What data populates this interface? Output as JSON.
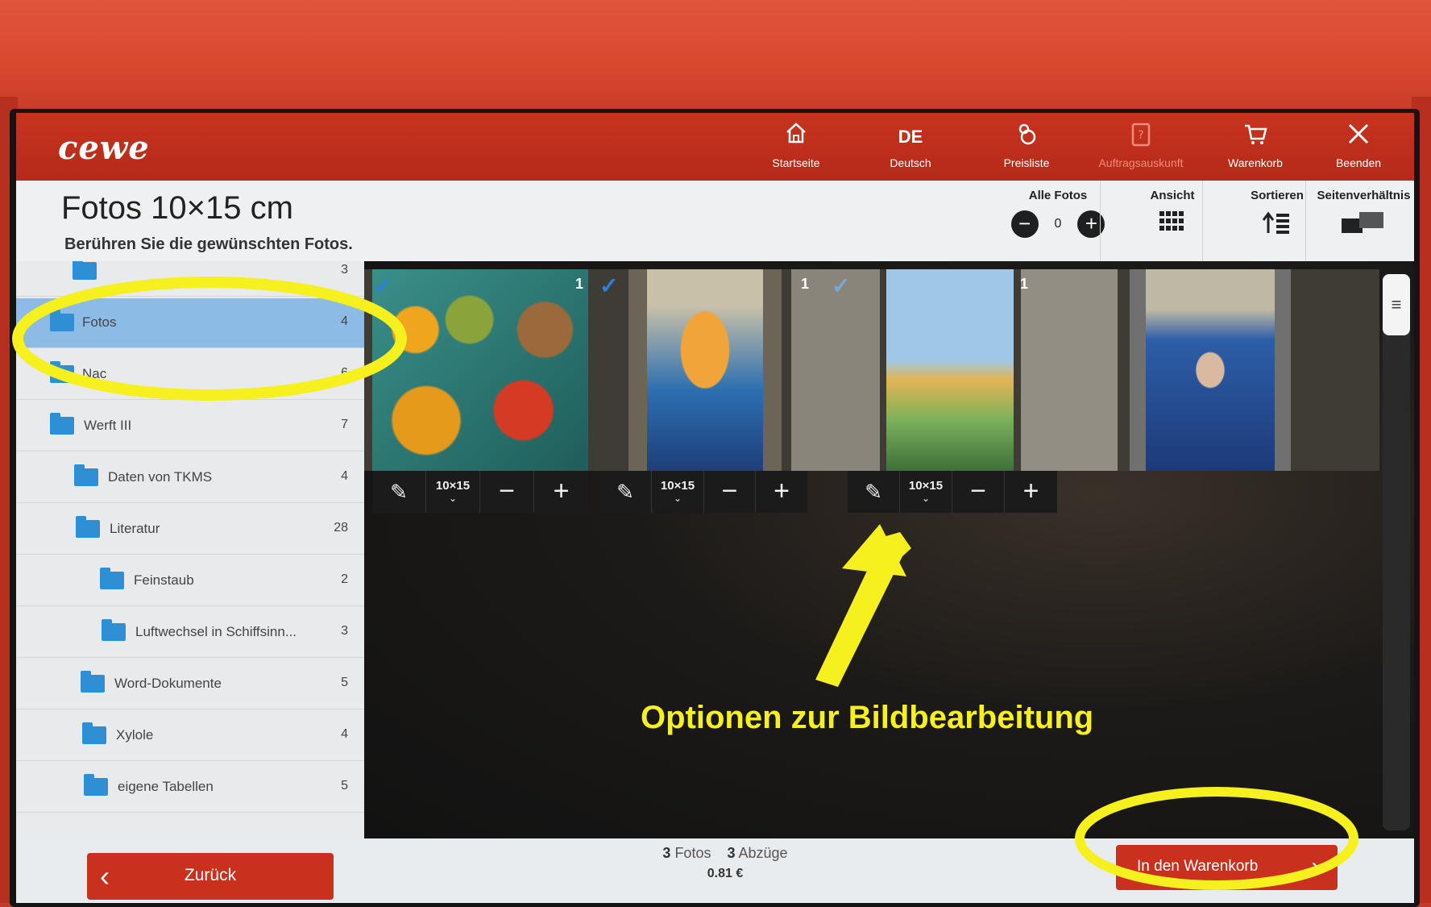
{
  "header": {
    "logo": "cewe",
    "nav": [
      {
        "label": "Startseite",
        "icon": "home-icon"
      },
      {
        "label": "Deutsch",
        "code": "DE"
      },
      {
        "label": "Preisliste",
        "icon": "price-tag-icon"
      },
      {
        "label": "Auftragsauskunft",
        "icon": "clipboard-icon"
      },
      {
        "label": "Warenkorb",
        "icon": "cart-icon"
      },
      {
        "label": "Beenden",
        "icon": "close-icon"
      }
    ]
  },
  "page": {
    "title": "Fotos 10×15 cm",
    "subtitle": "Berühren Sie die gewünschten Fotos."
  },
  "controls": {
    "all_photos_label": "Alle Fotos",
    "all_photos_count": "0",
    "view_label": "Ansicht",
    "sort_label": "Sortieren",
    "aspect_label": "Seitenverhältnis"
  },
  "folders": [
    {
      "name": "",
      "count": "3"
    },
    {
      "name": "Fotos",
      "count": "4",
      "selected": true
    },
    {
      "name": "Nac",
      "count": "6"
    },
    {
      "name": "Werft III",
      "count": "7"
    },
    {
      "name": "Daten von TKMS",
      "count": "4"
    },
    {
      "name": "Literatur",
      "count": "28"
    },
    {
      "name": "Feinstaub",
      "count": "2"
    },
    {
      "name": "Luftwechsel in Schiffsinn...",
      "count": "3"
    },
    {
      "name": "Word-Dokumente",
      "count": "5"
    },
    {
      "name": "Xylole",
      "count": "4"
    },
    {
      "name": "eigene Tabellen",
      "count": "5"
    }
  ],
  "photos": [
    {
      "qty": "1",
      "checked": true
    },
    {
      "qty": "1",
      "checked": true
    },
    {
      "qty": "1",
      "checked": true
    },
    {
      "qty": "",
      "checked": false
    }
  ],
  "photo_toolbar": {
    "size": "10×15",
    "minus": "−",
    "plus": "+"
  },
  "summary": {
    "photos_count": "3",
    "photos_label": "Fotos",
    "prints_count": "3",
    "prints_label": "Abzüge",
    "price": "0.81 €"
  },
  "footer": {
    "back_label": "Zurück",
    "cart_label": "In den Warenkorb"
  },
  "annotation": {
    "text": "Optionen zur Bildbearbeitung",
    "color": "#f5f01e"
  },
  "colors": {
    "brand_red": "#c9311e",
    "selection_blue": "#8cbbe6",
    "folder_blue": "#2f8fd5"
  }
}
